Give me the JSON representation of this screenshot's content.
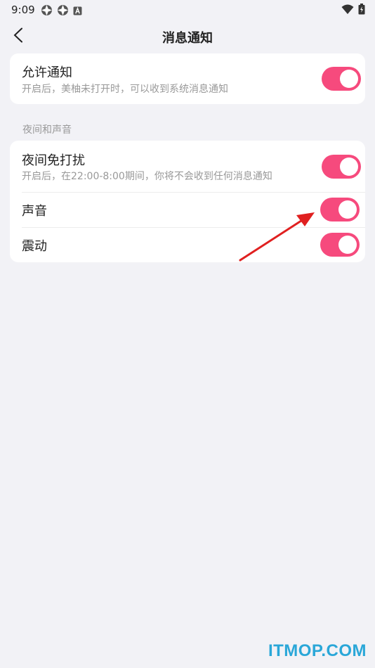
{
  "status": {
    "time": "9:09"
  },
  "header": {
    "title": "消息通知"
  },
  "allow_notify": {
    "title": "允许通知",
    "subtitle": "开启后，美柚未打开时，可以收到系统消息通知",
    "enabled": true
  },
  "section_label": "夜间和声音",
  "night_mode": {
    "title": "夜间免打扰",
    "subtitle": "开启后，在22:00-8:00期间，你将不会收到任何消息通知",
    "enabled": true
  },
  "sound": {
    "title": "声音",
    "enabled": true
  },
  "vibrate": {
    "title": "震动",
    "enabled": true
  },
  "watermark": "ITMOP.COM",
  "colors": {
    "accent": "#f64a7d",
    "background": "#f2f2f6",
    "arrow": "#e02020"
  }
}
